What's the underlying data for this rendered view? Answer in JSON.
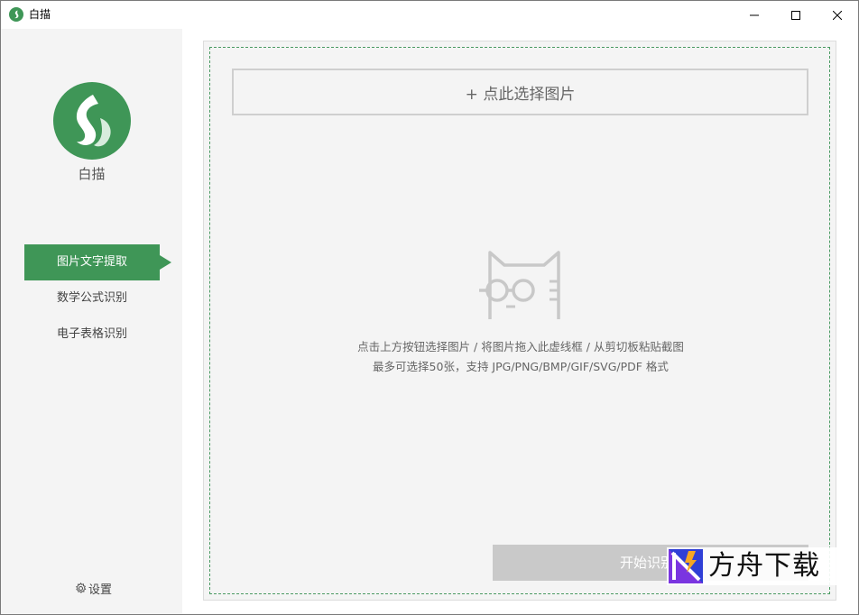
{
  "window": {
    "title": "白描",
    "controls": {
      "minimize": "minimize-icon",
      "maximize": "maximize-icon",
      "close": "close-icon"
    }
  },
  "sidebar": {
    "app_name": "白描",
    "nav": [
      {
        "label": "图片文字提取",
        "active": true
      },
      {
        "label": "数学公式识别",
        "active": false
      },
      {
        "label": "电子表格识别",
        "active": false
      }
    ],
    "settings_label": "设置"
  },
  "main": {
    "select_button_label": "+ 点此选择图片",
    "hint_line1": "点击上方按钮选择图片 / 将图片拖入此虚线框 / 从剪切板粘贴截图",
    "hint_line2": "最多可选择50张，支持 JPG/PNG/BMP/GIF/SVG/PDF 格式",
    "start_button_label": "开始识别"
  },
  "watermark": {
    "text": "方舟下载"
  },
  "colors": {
    "accent": "#3f9657",
    "sidebar_bg": "#f4f4f4",
    "panel_bg": "#f4f4f4",
    "dashed_border": "#4a9a62",
    "start_button_bg": "#c9c9c9"
  }
}
